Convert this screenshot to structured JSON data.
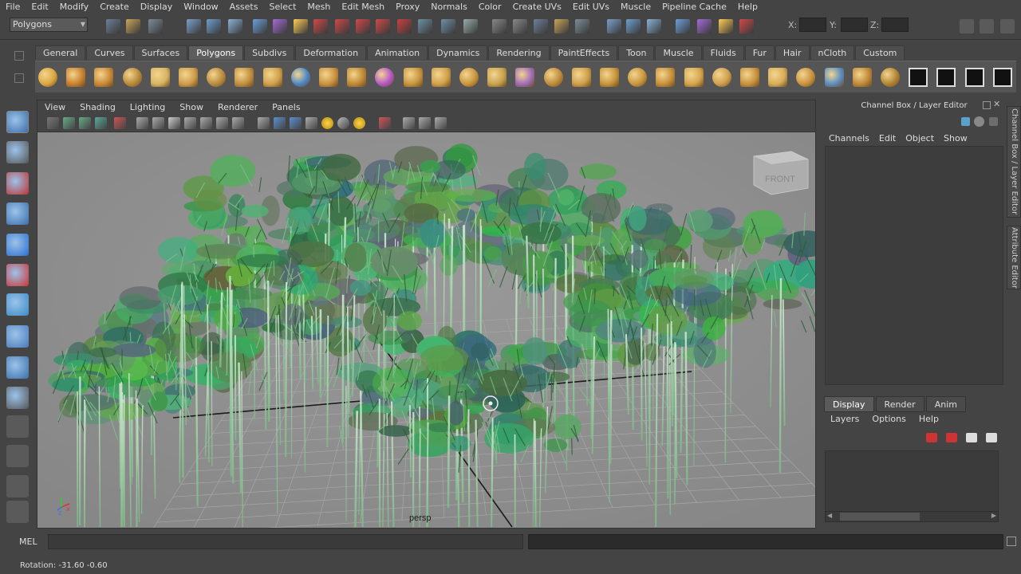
{
  "menubar": [
    "File",
    "Edit",
    "Modify",
    "Create",
    "Display",
    "Window",
    "Assets",
    "Select",
    "Mesh",
    "Edit Mesh",
    "Proxy",
    "Normals",
    "Color",
    "Create UVs",
    "Edit UVs",
    "Muscle",
    "Pipeline Cache",
    "Help"
  ],
  "status_line": {
    "mode": "Polygons",
    "x_label": "X:",
    "y_label": "Y:",
    "z_label": "Z:"
  },
  "shelf": {
    "tabs": [
      "General",
      "Curves",
      "Surfaces",
      "Polygons",
      "Subdivs",
      "Deformation",
      "Animation",
      "Dynamics",
      "Rendering",
      "PaintEffects",
      "Toon",
      "Muscle",
      "Fluids",
      "Fur",
      "Hair",
      "nCloth",
      "Custom"
    ],
    "active_tab": "Polygons"
  },
  "viewport": {
    "menu": [
      "View",
      "Shading",
      "Lighting",
      "Show",
      "Renderer",
      "Panels"
    ],
    "camera": "persp",
    "view_cube_label": "FRONT"
  },
  "channel_box": {
    "title": "Channel Box / Layer Editor",
    "menu": [
      "Channels",
      "Edit",
      "Object",
      "Show"
    ]
  },
  "layer_editor": {
    "tabs": [
      "Display",
      "Render",
      "Anim"
    ],
    "active_tab": "Display",
    "menu": [
      "Layers",
      "Options",
      "Help"
    ]
  },
  "side_tabs": [
    "Channel Box / Layer Editor",
    "Attribute Editor"
  ],
  "command_line": {
    "label": "MEL",
    "value": ""
  },
  "help_line": "Rotation:  -31.60    -0.60",
  "colors": {
    "accent": "#5d7fa8",
    "bamboo_dark": "#3f6e45",
    "bamboo_light": "#9ed8a6",
    "viewport_bg": "#8d8d8d"
  }
}
